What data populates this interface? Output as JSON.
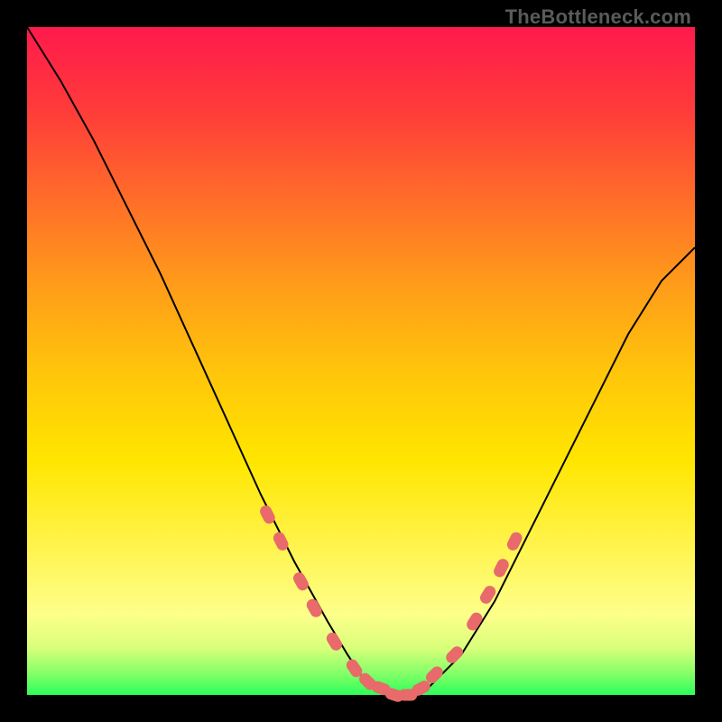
{
  "watermark": "TheBottleneck.com",
  "chart_data": {
    "type": "line",
    "title": "",
    "xlabel": "",
    "ylabel": "",
    "xlim": [
      0,
      100
    ],
    "ylim": [
      0,
      100
    ],
    "grid": false,
    "legend": false,
    "series": [
      {
        "name": "curve",
        "x": [
          0,
          5,
          10,
          15,
          20,
          25,
          30,
          35,
          40,
          45,
          48,
          50,
          52,
          55,
          58,
          60,
          62,
          65,
          70,
          75,
          80,
          85,
          90,
          95,
          100
        ],
        "y": [
          100,
          92,
          83,
          73,
          63,
          52,
          41,
          30,
          20,
          11,
          6,
          3,
          1,
          0,
          0,
          1,
          3,
          6,
          14,
          24,
          34,
          44,
          54,
          62,
          67
        ]
      }
    ],
    "annotations": {
      "markers_description": "salmon rounded dash markers clustered along the curve near the valley",
      "markers": [
        {
          "x": 36,
          "y": 27
        },
        {
          "x": 38,
          "y": 23
        },
        {
          "x": 41,
          "y": 17
        },
        {
          "x": 43,
          "y": 13
        },
        {
          "x": 46,
          "y": 8
        },
        {
          "x": 49,
          "y": 4
        },
        {
          "x": 51,
          "y": 2
        },
        {
          "x": 53,
          "y": 1
        },
        {
          "x": 55,
          "y": 0
        },
        {
          "x": 57,
          "y": 0
        },
        {
          "x": 59,
          "y": 1
        },
        {
          "x": 61,
          "y": 3
        },
        {
          "x": 64,
          "y": 6
        },
        {
          "x": 67,
          "y": 11
        },
        {
          "x": 69,
          "y": 15
        },
        {
          "x": 71,
          "y": 19
        },
        {
          "x": 73,
          "y": 23
        }
      ]
    },
    "background_gradient": {
      "top": "#ff1a4d",
      "bottom": "#2bff5a"
    }
  }
}
